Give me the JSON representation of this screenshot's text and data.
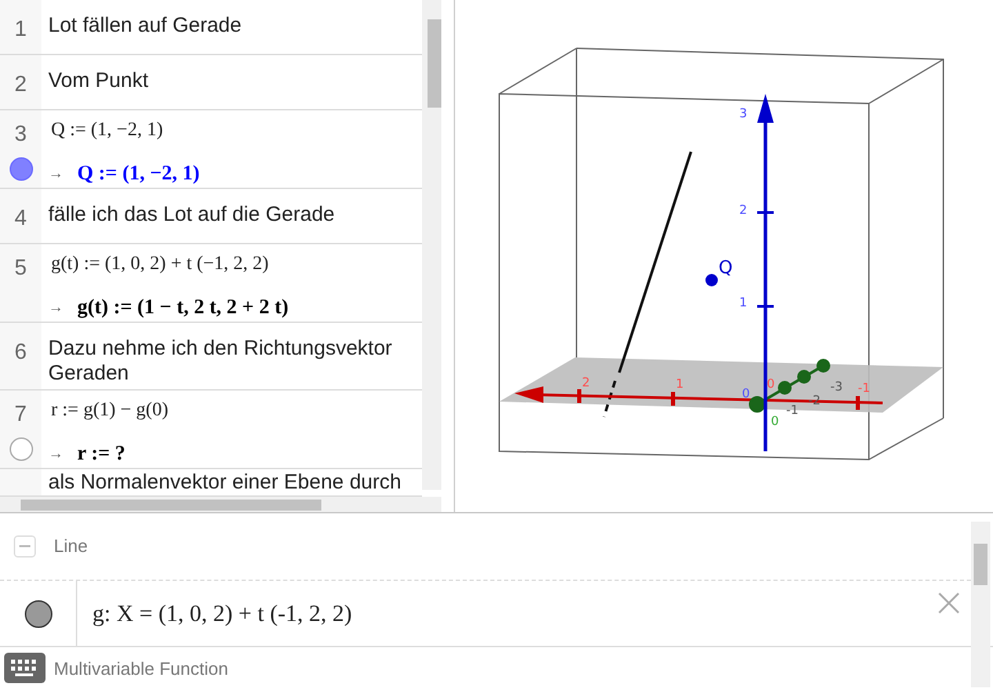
{
  "cas_rows": [
    {
      "number": "1",
      "kind": "text",
      "text": "Lot fällen auf Gerade"
    },
    {
      "number": "2",
      "kind": "text",
      "text": "Vom Punkt"
    },
    {
      "number": "3",
      "kind": "cas",
      "input": "Q := (1, −2, 1)",
      "arrow": "→",
      "output": "Q := (1, −2, 1)",
      "color": "#0000ff",
      "visible": true
    },
    {
      "number": "4",
      "kind": "text",
      "text": "fälle ich das Lot auf die Gerade"
    },
    {
      "number": "5",
      "kind": "cas",
      "input": "g(t) := (1, 0, 2) + t (−1, 2, 2)",
      "arrow": "→",
      "output": "g(t) := (1 − t, 2 t, 2 + 2 t)",
      "color": "#000000"
    },
    {
      "number": "6",
      "kind": "text",
      "text": "Dazu nehme ich den Richtungsvektor Geraden"
    },
    {
      "number": "7",
      "kind": "cas",
      "input": "r := g(1) − g(0)",
      "arrow": "→",
      "output": "r := ?",
      "color": "#000000",
      "visible": false
    },
    {
      "number": "",
      "kind": "text",
      "text": "als Normalenvektor einer Ebene durch"
    }
  ],
  "view3d": {
    "z_labels": [
      "3",
      "2",
      "1"
    ],
    "x_labels": [
      "2",
      "1",
      "0",
      "-1"
    ],
    "y_labels": [
      "0",
      "-1",
      "-2",
      "-3"
    ],
    "origin_label": "0",
    "point_label": "Q"
  },
  "algebra": {
    "groups": [
      {
        "title": "Line",
        "expanded": true,
        "items": [
          {
            "formula": "g: X = (1, 0, 2) + t (-1, 2, 2)",
            "visible": true
          }
        ]
      },
      {
        "title": "Multivariable Function"
      }
    ]
  }
}
